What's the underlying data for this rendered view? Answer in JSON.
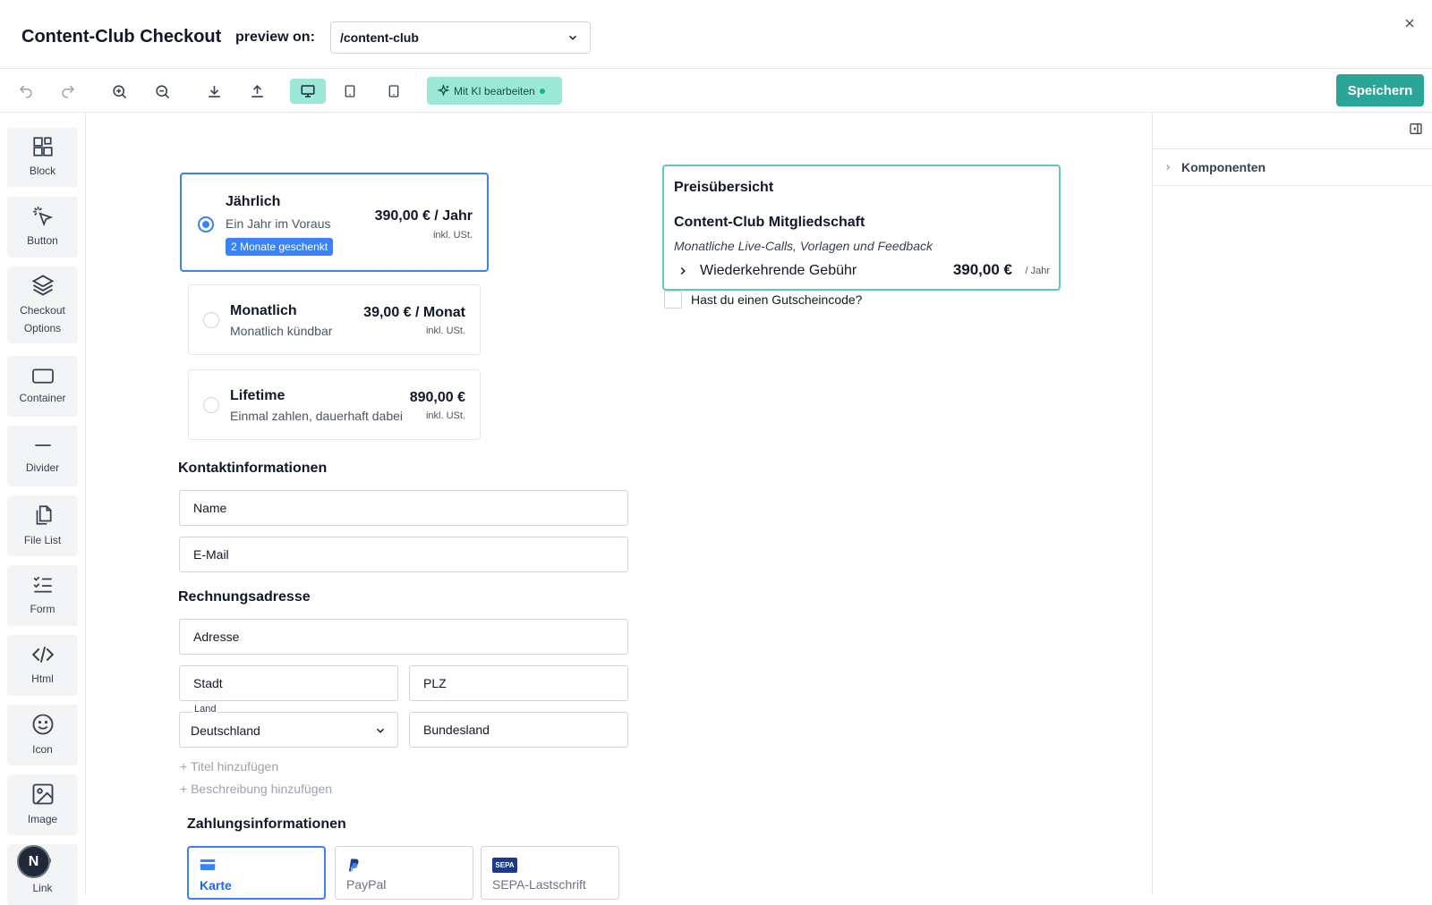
{
  "header": {
    "title": "Content-Club Checkout",
    "preview_label": "preview on:",
    "preview_value": "/content-club"
  },
  "toolbar": {
    "ai_label": "Mit KI bearbeiten",
    "save_label": "Speichern",
    "active_device": "desktop"
  },
  "sidebar": {
    "items": [
      {
        "label": "Block",
        "icon": "blocks-icon"
      },
      {
        "label": "Button",
        "icon": "cursor-click-icon"
      },
      {
        "label": "Checkout\nOptions",
        "icon": "layers-icon"
      },
      {
        "label": "Container",
        "icon": "rectangle-icon"
      },
      {
        "label": "Divider",
        "icon": "divider-icon"
      },
      {
        "label": "File List",
        "icon": "files-icon"
      },
      {
        "label": "Form",
        "icon": "checklist-icon"
      },
      {
        "label": "Html",
        "icon": "code-icon"
      },
      {
        "label": "Icon",
        "icon": "smiley-icon"
      },
      {
        "label": "Image",
        "icon": "image-icon"
      },
      {
        "label": "Link",
        "icon": "link-icon"
      }
    ],
    "avatar_letter": "N"
  },
  "plans": [
    {
      "name": "Jährlich",
      "desc": "Ein Jahr im Voraus",
      "badge": "2 Monate geschenkt",
      "price": "390,00 € / Jahr",
      "tax": "inkl. USt.",
      "selected": true
    },
    {
      "name": "Monatlich",
      "desc": "Monatlich kündbar",
      "price": "39,00 € / Monat",
      "tax": "inkl. USt.",
      "selected": false
    },
    {
      "name": "Lifetime",
      "desc": "Einmal zahlen, dauerhaft dabei",
      "price": "890,00 €",
      "tax": "inkl. USt.",
      "selected": false
    }
  ],
  "contact": {
    "heading": "Kontaktinformationen",
    "name_placeholder": "Name",
    "email_placeholder": "E-Mail"
  },
  "billing": {
    "heading": "Rechnungsadresse",
    "address_placeholder": "Adresse",
    "city_placeholder": "Stadt",
    "zip_placeholder": "PLZ",
    "country_label": "Land",
    "country_value": "Deutschland",
    "state_placeholder": "Bundesland",
    "add_title": "+ Titel hinzufügen",
    "add_description": "+ Beschreibung hinzufügen"
  },
  "payment": {
    "heading": "Zahlungsinformationen",
    "methods": [
      {
        "label": "Karte",
        "selected": true
      },
      {
        "label": "PayPal",
        "selected": false
      },
      {
        "label": "SEPA-Lastschrift",
        "selected": false
      }
    ],
    "sepa_logo_text": "SEPA"
  },
  "summary": {
    "title": "Preisübersicht",
    "product": "Content-Club Mitgliedschaft",
    "description": "Monatliche Live-Calls, Vorlagen und Feedback",
    "fee_label": "Wiederkehrende Gebühr",
    "price": "390,00 €",
    "unit": "/ Jahr",
    "coupon_label": "Hast du einen Gutscheincode?"
  },
  "right_panel": {
    "section_label": "Komponenten"
  },
  "colors": {
    "accent": "#2aa597",
    "ai_bg": "#9be8d6",
    "selection": "#3b82f6",
    "summary_border": "#5ec9b8"
  }
}
